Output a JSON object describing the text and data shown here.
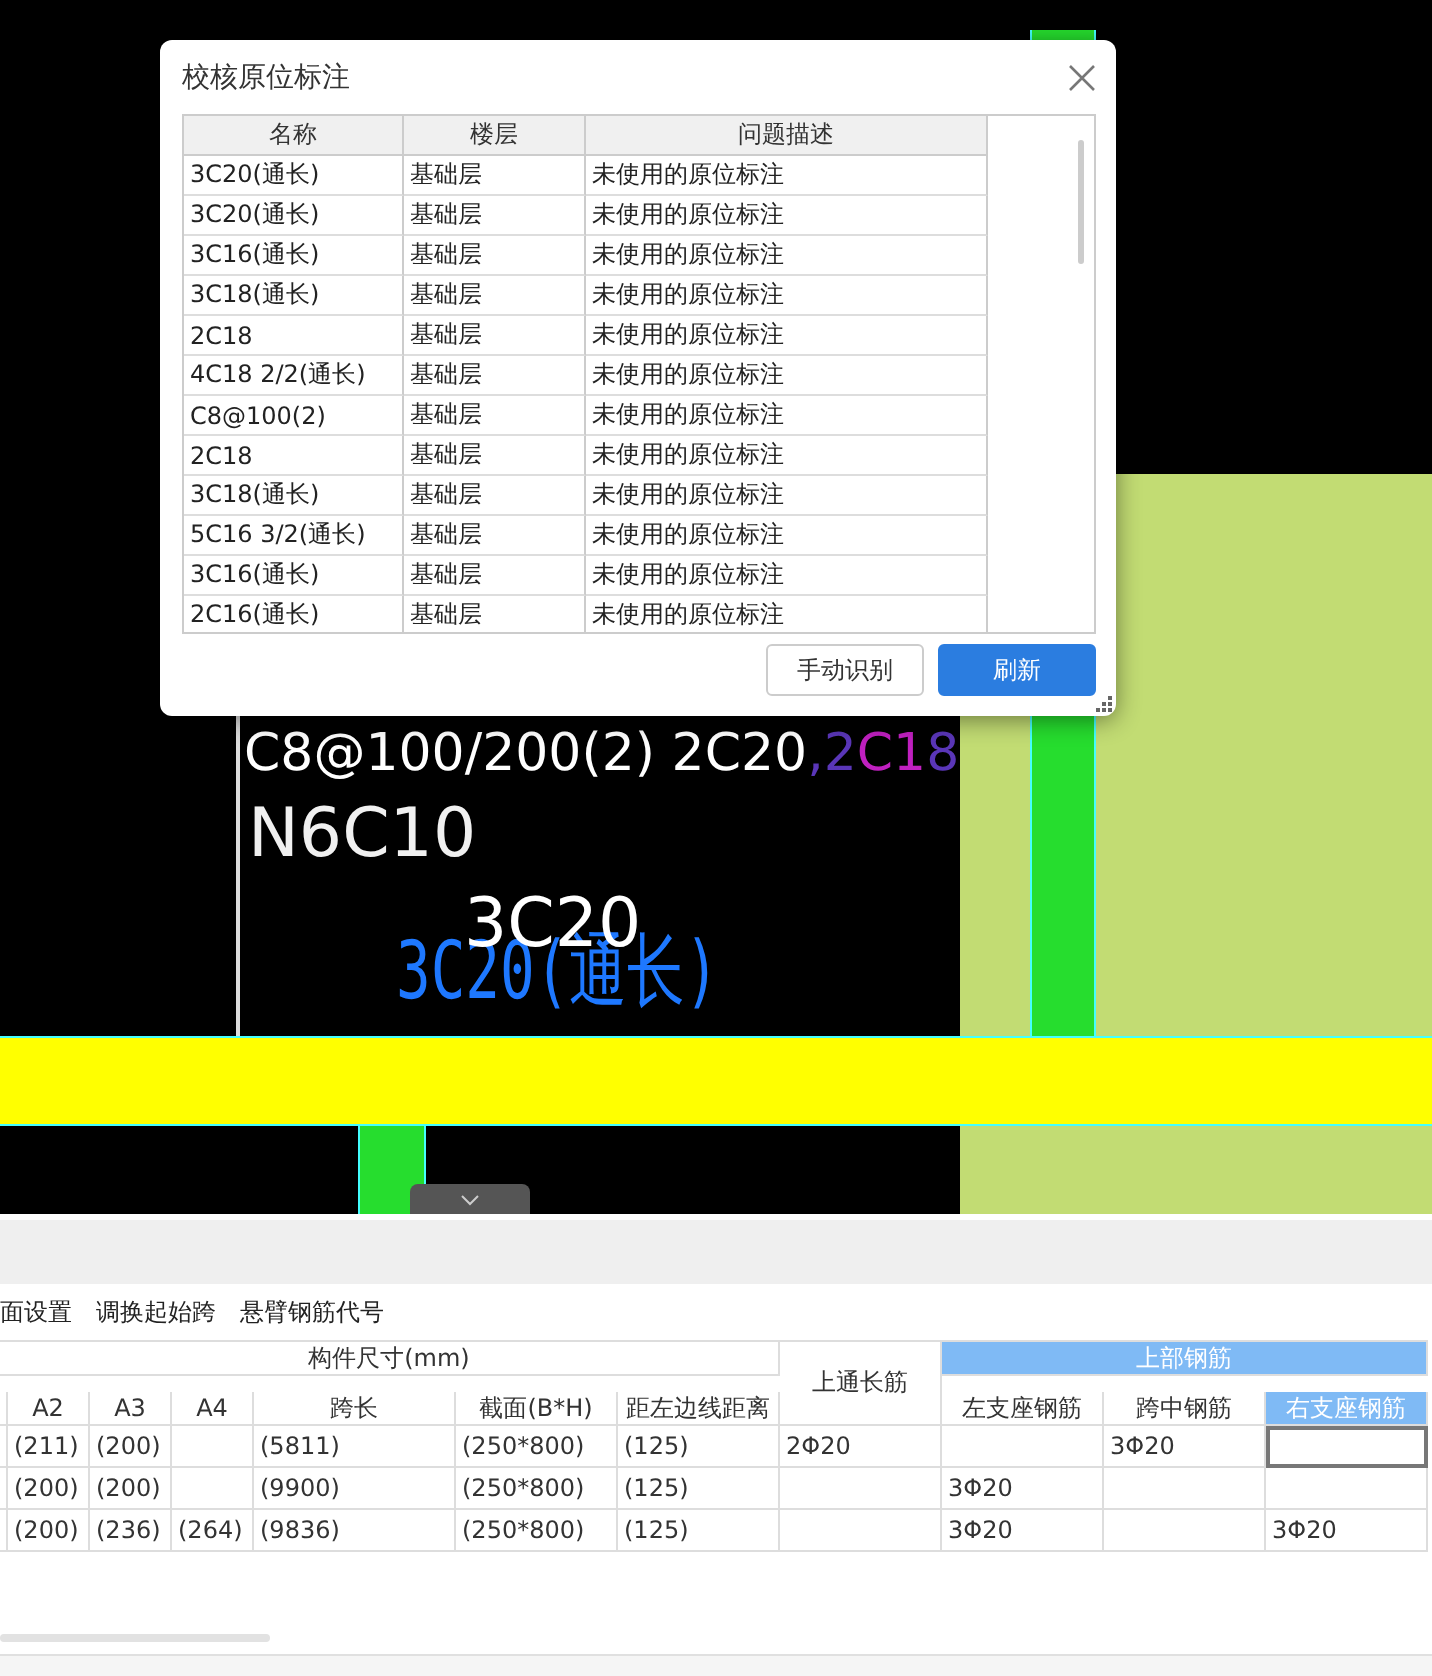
{
  "canvas": {
    "labels": [
      {
        "kind": "mixed",
        "segments": [
          {
            "text": "C8@100/200(2) 2C20",
            "color": "#ffffff"
          },
          {
            "text": ",2",
            "color": "#5a36b8"
          },
          {
            "text": "C1",
            "color": "#c020c0"
          },
          {
            "text": "8",
            "color": "#5a36b8"
          }
        ]
      },
      {
        "kind": "plain",
        "text": "N6C10"
      },
      {
        "kind": "plain",
        "text": "3C20"
      },
      {
        "kind": "outline",
        "text": "3C20(通长)"
      }
    ]
  },
  "dialog": {
    "title": "校核原位标注",
    "columns": [
      "名称",
      "楼层",
      "问题描述"
    ],
    "rows": [
      {
        "name": "3C20(通长)",
        "floor": "基础层",
        "issue": "未使用的原位标注"
      },
      {
        "name": "3C20(通长)",
        "floor": "基础层",
        "issue": "未使用的原位标注"
      },
      {
        "name": "3C16(通长)",
        "floor": "基础层",
        "issue": "未使用的原位标注"
      },
      {
        "name": "3C18(通长)",
        "floor": "基础层",
        "issue": "未使用的原位标注"
      },
      {
        "name": "2C18",
        "floor": "基础层",
        "issue": "未使用的原位标注"
      },
      {
        "name": "4C18 2/2(通长)",
        "floor": "基础层",
        "issue": "未使用的原位标注"
      },
      {
        "name": "C8@100(2)",
        "floor": "基础层",
        "issue": "未使用的原位标注"
      },
      {
        "name": "2C18",
        "floor": "基础层",
        "issue": "未使用的原位标注"
      },
      {
        "name": "3C18(通长)",
        "floor": "基础层",
        "issue": "未使用的原位标注"
      },
      {
        "name": "5C16 3/2(通长)",
        "floor": "基础层",
        "issue": "未使用的原位标注"
      },
      {
        "name": "3C16(通长)",
        "floor": "基础层",
        "issue": "未使用的原位标注"
      },
      {
        "name": "2C16(通长)",
        "floor": "基础层",
        "issue": "未使用的原位标注"
      }
    ],
    "buttons": [
      {
        "label": "手动识别",
        "kind": "secondary"
      },
      {
        "label": "刷新",
        "kind": "primary"
      }
    ]
  },
  "toolbar": {
    "items": [
      "面设置",
      "调换起始跨",
      "悬臂钢筋代号"
    ]
  },
  "grid": {
    "group_size": "构件尺寸(mm)",
    "group_top": "上部钢筋",
    "columns": [
      {
        "label": "A2",
        "selected": false
      },
      {
        "label": "A3",
        "selected": false
      },
      {
        "label": "A4",
        "selected": false
      },
      {
        "label": "跨长",
        "selected": false
      },
      {
        "label": "截面(B*H)",
        "selected": false
      },
      {
        "label": "距左边线距离",
        "selected": false
      },
      {
        "label": "上通长筋",
        "selected": false
      },
      {
        "label": "左支座钢筋",
        "selected": false
      },
      {
        "label": "跨中钢筋",
        "selected": false
      },
      {
        "label": "右支座钢筋",
        "selected": true
      }
    ],
    "rows": [
      {
        "cells": [
          {
            "text": "(211)",
            "selected": false
          },
          {
            "text": "(200)",
            "selected": false
          },
          {
            "selected": false
          },
          {
            "text": "(5811)",
            "selected": false
          },
          {
            "text": "(250*800)",
            "selected": false
          },
          {
            "text": "(125)",
            "selected": false
          },
          {
            "text": "2Φ20",
            "selected": false
          },
          {
            "selected": false
          },
          {
            "text": "3Φ20",
            "selected": false
          },
          {
            "selected": true
          }
        ]
      },
      {
        "cells": [
          {
            "text": "(200)",
            "selected": false
          },
          {
            "text": "(200)",
            "selected": false
          },
          {
            "selected": false
          },
          {
            "text": "(9900)",
            "selected": false
          },
          {
            "text": "(250*800)",
            "selected": false
          },
          {
            "text": "(125)",
            "selected": false
          },
          {
            "selected": false
          },
          {
            "text": "3Φ20",
            "selected": false
          },
          {
            "selected": false
          },
          {
            "selected": false
          }
        ]
      },
      {
        "cells": [
          {
            "text": "(200)",
            "selected": false
          },
          {
            "text": "(236)",
            "selected": false
          },
          {
            "text": "(264)",
            "selected": false
          },
          {
            "text": "(9836)",
            "selected": false
          },
          {
            "text": "(250*800)",
            "selected": false
          },
          {
            "text": "(125)",
            "selected": false
          },
          {
            "selected": false
          },
          {
            "text": "3Φ20",
            "selected": false
          },
          {
            "selected": false
          },
          {
            "text": "3Φ20",
            "selected": false
          }
        ]
      }
    ]
  }
}
